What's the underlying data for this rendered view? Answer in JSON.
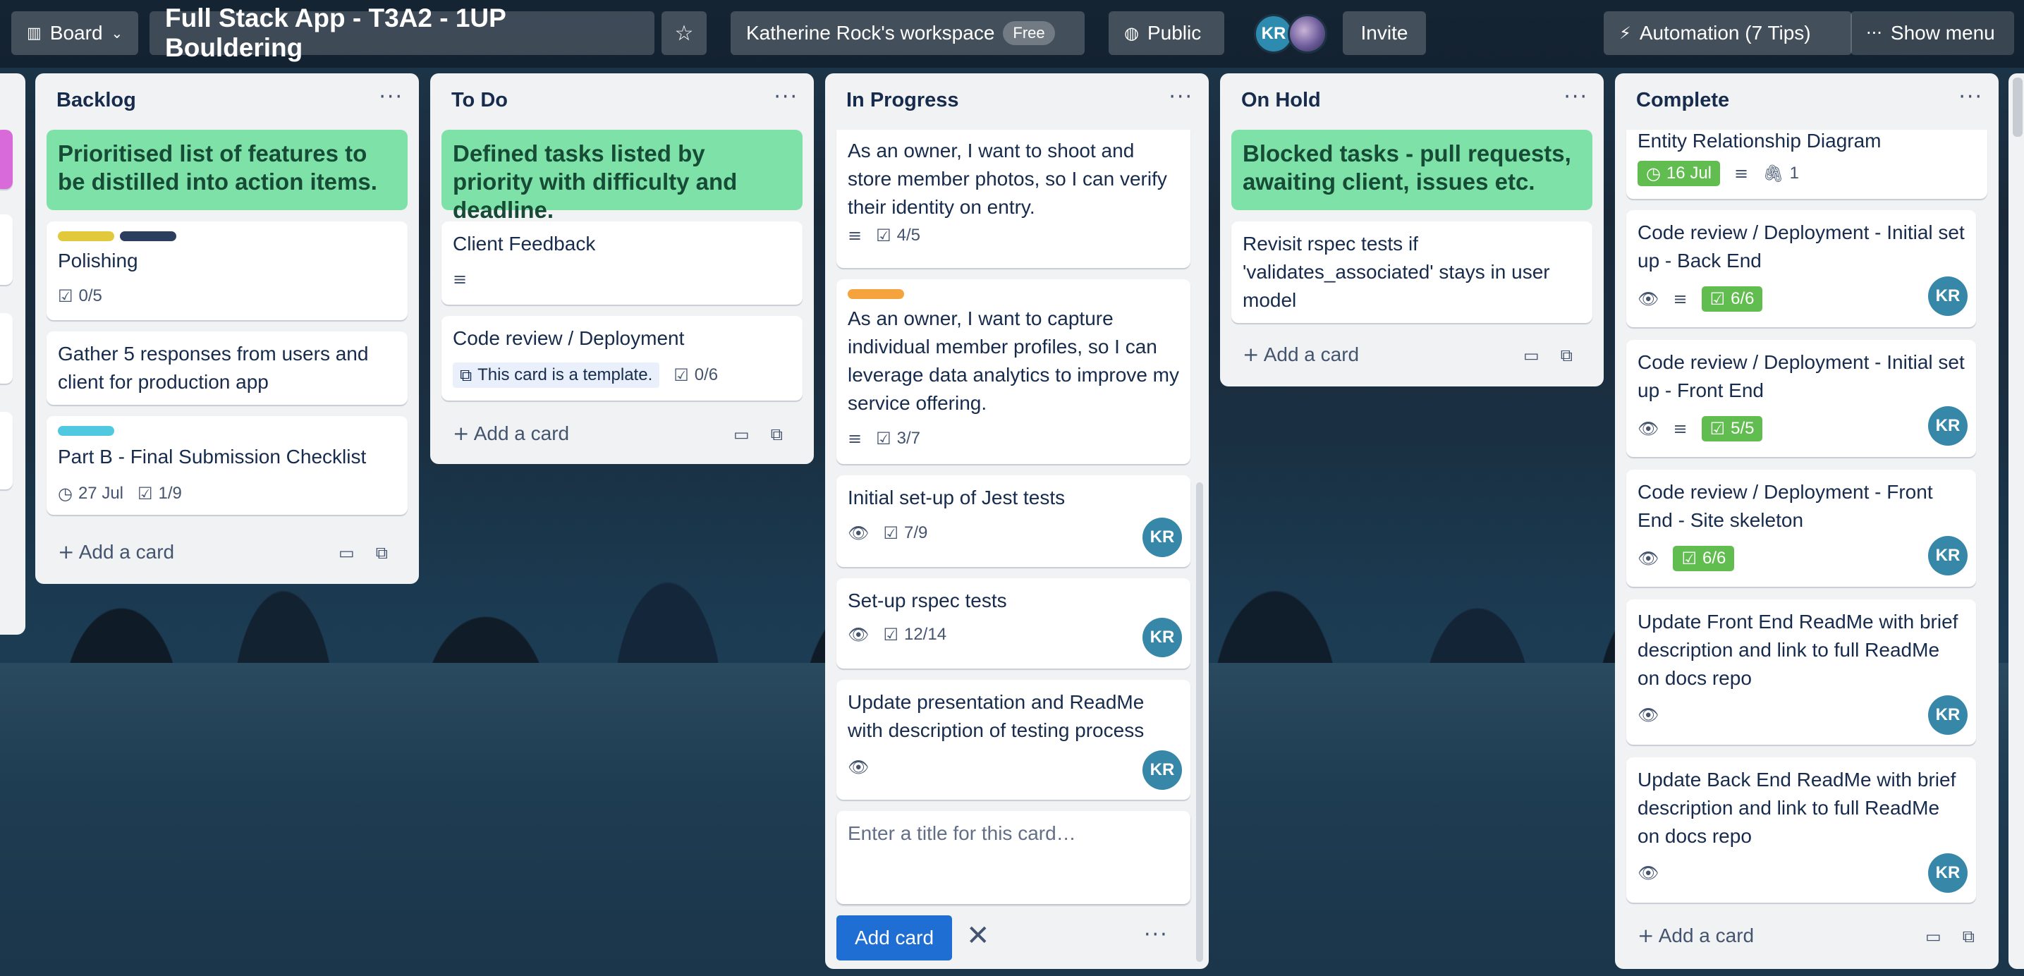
{
  "header": {
    "board_view": "Board",
    "board_title": "Full Stack App - T3A2 - 1UP Bouldering",
    "workspace": "Katherine Rock's workspace",
    "workspace_plan": "Free",
    "visibility": "Public",
    "member_initials": "KR",
    "invite": "Invite",
    "automation": "Automation (7 Tips)",
    "show_menu": "Show menu"
  },
  "lists": {
    "backlog": {
      "title": "Backlog",
      "cards": [
        {
          "text": "Prioritised list of features to be distilled into action items."
        },
        {
          "text": "Polishing",
          "checklist": "0/5"
        },
        {
          "text": "Gather 5 responses from users and client for production app"
        },
        {
          "text": "Part B - Final Submission Checklist",
          "due": "27 Jul",
          "checklist": "1/9"
        }
      ],
      "add": "Add a card"
    },
    "todo": {
      "title": "To Do",
      "cards": [
        {
          "text": "Defined tasks listed by priority with difficulty and deadline."
        },
        {
          "text": "Client Feedback"
        },
        {
          "text": "Code review / Deployment",
          "template": "This card is a template.",
          "checklist": "0/6"
        }
      ],
      "add": "Add a card"
    },
    "inprogress": {
      "title": "In Progress",
      "cards": [
        {
          "text": "As an owner, I want to shoot and store member photos, so I can verify their identity on entry.",
          "checklist": "4/5"
        },
        {
          "text": "As an owner, I want to capture individual member profiles, so I can leverage data analytics to improve my service offering.",
          "checklist": "3/7"
        },
        {
          "text": "Initial set-up of Jest tests",
          "checklist": "7/9",
          "member": "KR"
        },
        {
          "text": "Set-up rspec tests",
          "checklist": "12/14",
          "member": "KR"
        },
        {
          "text": "Update presentation and ReadMe with description of testing process",
          "member": "KR"
        }
      ],
      "composer_placeholder": "Enter a title for this card…",
      "composer_add": "Add card"
    },
    "onhold": {
      "title": "On Hold",
      "cards": [
        {
          "text": "Blocked tasks - pull requests, awaiting client, issues etc."
        },
        {
          "text": "Revisit rspec tests if 'validates_associated' stays in user model"
        }
      ],
      "add": "Add a card"
    },
    "complete": {
      "title": "Complete",
      "cards": [
        {
          "text": "Entity Relationship Diagram",
          "due": "16 Jul",
          "attachments": "1"
        },
        {
          "text": "Code review / Deployment - Initial set up - Back End",
          "checklist": "6/6",
          "member": "KR"
        },
        {
          "text": "Code review / Deployment - Initial set up - Front End",
          "checklist": "5/5",
          "member": "KR"
        },
        {
          "text": "Code review / Deployment - Front End - Site skeleton",
          "checklist": "6/6",
          "member": "KR"
        },
        {
          "text": "Update Front End ReadMe with brief description and link to full ReadMe on docs repo",
          "member": "KR"
        },
        {
          "text": "Update Back End ReadMe with brief description and link to full ReadMe on docs repo",
          "member": "KR"
        }
      ],
      "add": "Add a card"
    }
  },
  "colors": {
    "green_card": "#7ee2a8",
    "label_yellow": "#e2c93c",
    "label_navy": "#2c3e5d",
    "label_cyan": "#4fc8e0",
    "label_orange": "#f5a33c",
    "badge_green": "#61bd4f",
    "primary_button": "#0c66e4"
  },
  "icons": [
    "board-icon",
    "chevron-down-icon",
    "star-icon",
    "globe-icon",
    "bolt-icon",
    "ellipsis-icon",
    "description-icon",
    "checklist-icon",
    "clock-icon",
    "eye-icon",
    "attachment-icon",
    "plus-icon",
    "template-icon",
    "close-icon"
  ]
}
